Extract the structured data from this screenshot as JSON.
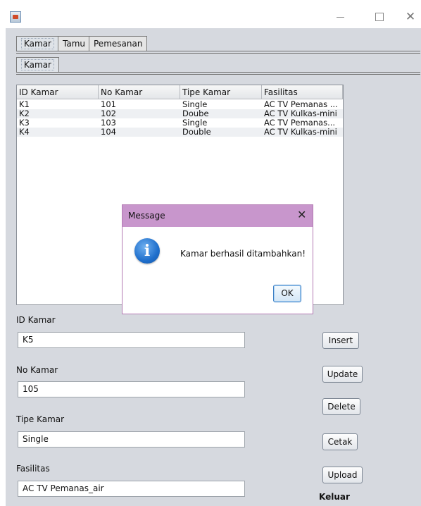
{
  "window": {
    "icon": "java-app-icon",
    "minimize_glyph": "—",
    "maximize_glyph": "☐",
    "close_glyph": "✕"
  },
  "tabs": {
    "main": [
      "Kamar",
      "Tamu",
      "Pemesanan"
    ],
    "main_selected": "Kamar",
    "sub": [
      "Kamar"
    ]
  },
  "table": {
    "columns": [
      "ID Kamar",
      "No Kamar",
      "Tipe Kamar",
      "Fasilitas"
    ],
    "rows": [
      [
        "K1",
        "101",
        "Single",
        "AC TV Pemanas ..."
      ],
      [
        "K2",
        "102",
        "Doube",
        "AC TV Kulkas-mini"
      ],
      [
        "K3",
        "103",
        "Single",
        "AC TV Pemanas..."
      ],
      [
        "K4",
        "104",
        "Double",
        "AC TV Kulkas-mini"
      ]
    ]
  },
  "form": {
    "id_label": "ID Kamar",
    "id_value": "K5",
    "no_label": "No Kamar",
    "no_value": "105",
    "tipe_label": "Tipe Kamar",
    "tipe_value": "Single",
    "fasilitas_label": "Fasilitas",
    "fasilitas_value": "AC TV Pemanas_air"
  },
  "buttons": {
    "insert": "Insert",
    "update": "Update",
    "delete": "Delete",
    "cetak": "Cetak",
    "upload": "Upload",
    "keluar": "Keluar"
  },
  "dialog": {
    "title": "Message",
    "close_glyph": "✕",
    "icon": "information-icon",
    "icon_glyph": "i",
    "message": "Kamar berhasil ditambahkan!",
    "ok_label": "OK",
    "title_color": "#c896cc"
  }
}
